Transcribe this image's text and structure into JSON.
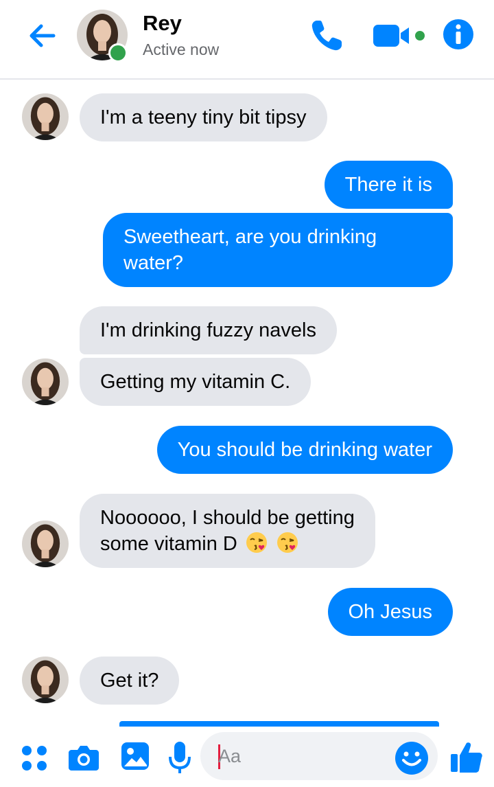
{
  "header": {
    "contact_name": "Rey",
    "status": "Active now",
    "icons": [
      "back-arrow-icon",
      "phone-icon",
      "video-camera-icon",
      "info-icon"
    ]
  },
  "messages": [
    {
      "side": "in",
      "text": "I'm a teeny tiny bit tipsy"
    },
    {
      "side": "out",
      "text": "There it is"
    },
    {
      "side": "out",
      "text": "Sweetheart, are you drinking water?"
    },
    {
      "side": "in",
      "text": "I'm drinking fuzzy navels"
    },
    {
      "side": "in",
      "text": "Getting my vitamin C."
    },
    {
      "side": "out",
      "text": "You should be drinking water"
    },
    {
      "side": "in",
      "text": "Noooooo, I should be getting",
      "text_line2": "some vitamin D",
      "emoji": [
        "kissing-heart-emoji",
        "kissing-heart-emoji"
      ]
    },
    {
      "side": "out",
      "text": "Oh Jesus"
    },
    {
      "side": "in",
      "text": "Get it?"
    }
  ],
  "composer": {
    "placeholder": "Aa",
    "icons": [
      "apps-grid-icon",
      "camera-icon",
      "photo-icon",
      "microphone-icon",
      "emoji-icon",
      "thumbs-up-icon"
    ]
  },
  "colors": {
    "accent": "#0084ff",
    "incoming_bubble": "#e4e6eb",
    "online": "#31a24c",
    "status_text": "#65676b"
  }
}
